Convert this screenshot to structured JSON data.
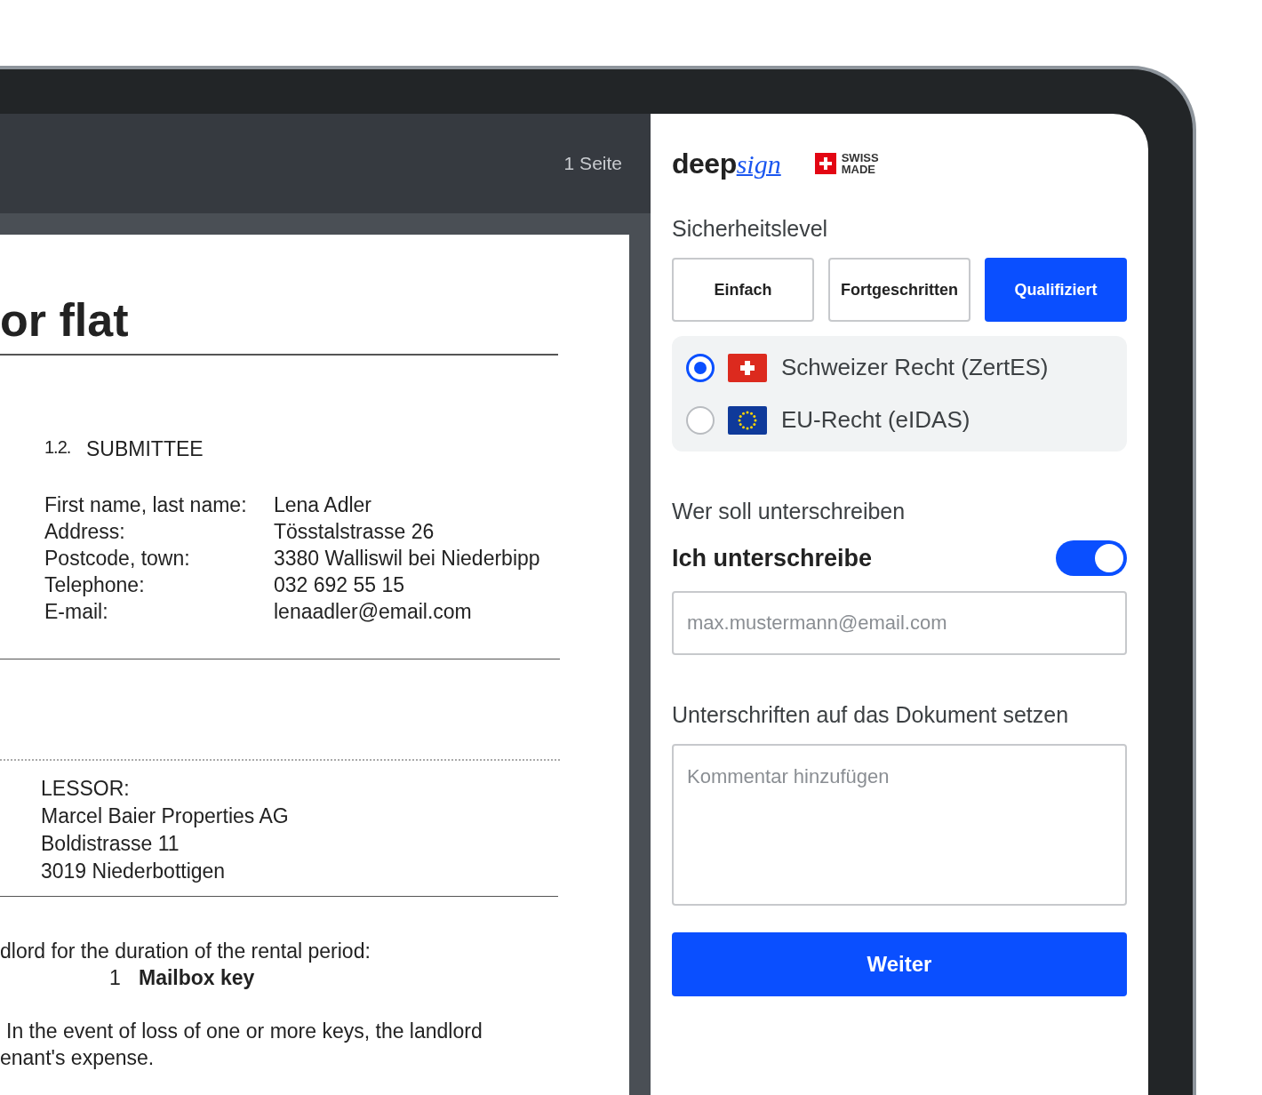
{
  "viewer": {
    "page_count": "1 Seite"
  },
  "document": {
    "title_fragment": "or flat",
    "section": {
      "number": "1.2.",
      "title": "SUBMITTEE"
    },
    "fields": [
      {
        "label": "First name, last name:",
        "value": "Lena Adler"
      },
      {
        "label": "Address:",
        "value": "Tösstalstrasse 26"
      },
      {
        "label": "Postcode, town:",
        "value": "3380 Walliswil bei Niederbipp"
      },
      {
        "label": "Telephone:",
        "value": "032 692 55 15"
      },
      {
        "label": "E-mail:",
        "value": "lenaadler@email.com"
      }
    ],
    "lessor_lines": [
      "LESSOR:",
      "Marcel Baier Properties AG",
      "Boldistrasse 11",
      "3019 Niederbottigen"
    ],
    "clause_fragment": "dlord for the duration of the rental period:",
    "item": {
      "quantity": "1",
      "name": "Mailbox key"
    },
    "paragraph_lines": [
      "In the event of loss of one or more keys, the landlord",
      "enant's expense."
    ]
  },
  "panel": {
    "logo": {
      "wordmark": "deep",
      "script": "sign"
    },
    "badge": {
      "lines": [
        "SWISS",
        "MADE"
      ]
    },
    "security": {
      "label": "Sicherheitslevel",
      "levels": [
        {
          "label": "Einfach",
          "selected": false
        },
        {
          "label": "Fortgeschritten",
          "selected": false
        },
        {
          "label": "Qualifiziert",
          "selected": true
        }
      ],
      "jurisdictions": [
        {
          "label": "Schweizer Recht (ZertES)",
          "kind": "swiss",
          "selected": true
        },
        {
          "label": "EU-Recht (eIDAS)",
          "kind": "eu",
          "selected": false
        }
      ]
    },
    "signers": {
      "label": "Wer soll unterschreiben",
      "self_sign": {
        "label": "Ich unterschreibe",
        "on": true
      },
      "email": {
        "placeholder": "max.mustermann@email.com"
      }
    },
    "placement": {
      "label": "Unterschriften auf das Dokument setzen",
      "comment": {
        "placeholder": "Kommentar hinzufügen"
      }
    },
    "button": "Weiter"
  }
}
